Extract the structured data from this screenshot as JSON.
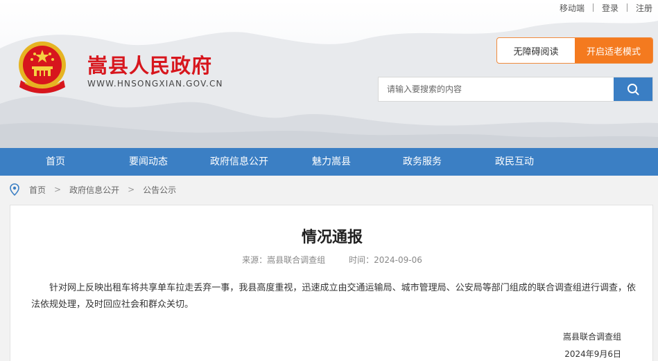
{
  "topbar": {
    "mobile": "移动端",
    "login": "登录",
    "register": "注册"
  },
  "site": {
    "title": "嵩县人民政府",
    "url": "WWW.HNSONGXIAN.GOV.CN"
  },
  "modes": {
    "accessible": "无障碍阅读",
    "elder": "开启适老模式"
  },
  "search": {
    "placeholder": "请输入要搜索的内容"
  },
  "nav": {
    "items": [
      "首页",
      "要闻动态",
      "政府信息公开",
      "魅力嵩县",
      "政务服务",
      "政民互动"
    ]
  },
  "breadcrumb": {
    "items": [
      "首页",
      "政府信息公开",
      "公告公示"
    ]
  },
  "article": {
    "title": "情况通报",
    "source": "来源：嵩县联合调查组",
    "time": "时间：2024-09-06",
    "body": "针对网上反映出租车将共享单车拉走丢弃一事，我县高度重视，迅速成立由交通运输局、城市管理局、公安局等部门组成的联合调查组进行调查，依法依规处理，及时回应社会和群众关切。",
    "signature": "嵩县联合调查组",
    "date": "2024年9月6日"
  },
  "colors": {
    "brand_red": "#d7161d",
    "nav_blue": "#3b7fc4",
    "elder_orange": "#f47a1f"
  }
}
